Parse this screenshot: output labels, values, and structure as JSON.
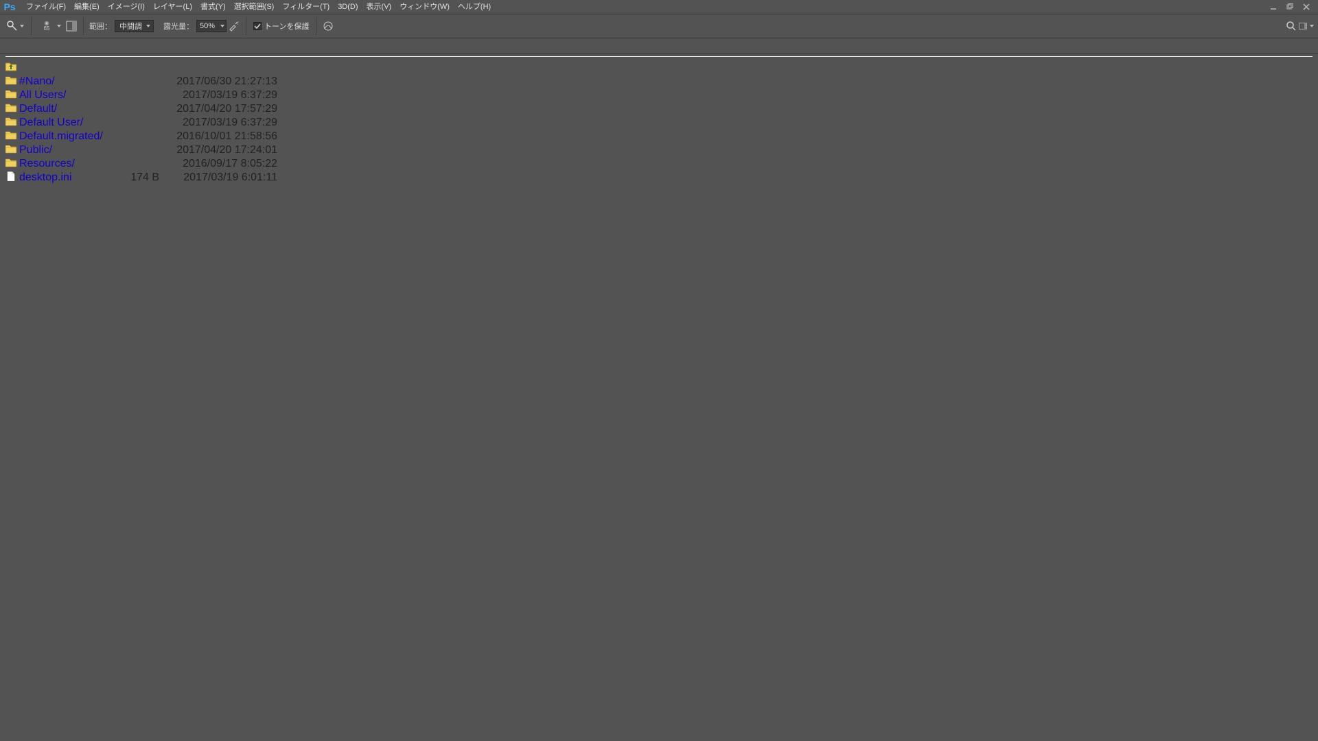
{
  "menubar": {
    "items": [
      "ファイル(F)",
      "編集(E)",
      "イメージ(I)",
      "レイヤー(L)",
      "書式(Y)",
      "選択範囲(S)",
      "フィルター(T)",
      "3D(D)",
      "表示(V)",
      "ウィンドウ(W)",
      "ヘルプ(H)"
    ]
  },
  "options": {
    "brush_size": "65",
    "range_label": "範囲：",
    "range_value": "中間調",
    "exposure_label": "露光量：",
    "exposure_value": "50%",
    "protect_tones": "トーンを保護"
  },
  "filelist": {
    "rows": [
      {
        "type": "up",
        "name": "",
        "size": "",
        "date": ""
      },
      {
        "type": "folder",
        "name": "#Nano/",
        "size": "",
        "date": "2017/06/30 21:27:13"
      },
      {
        "type": "folder",
        "name": "All Users/",
        "size": "",
        "date": "2017/03/19 6:37:29"
      },
      {
        "type": "folder",
        "name": "Default/",
        "size": "",
        "date": "2017/04/20 17:57:29"
      },
      {
        "type": "folder",
        "name": "Default User/",
        "size": "",
        "date": "2017/03/19 6:37:29"
      },
      {
        "type": "folder",
        "name": "Default.migrated/",
        "size": "",
        "date": "2016/10/01 21:58:56"
      },
      {
        "type": "folder",
        "name": "Public/",
        "size": "",
        "date": "2017/04/20 17:24:01"
      },
      {
        "type": "folder",
        "name": "Resources/",
        "size": "",
        "date": "2016/09/17 8:05:22"
      },
      {
        "type": "file",
        "name": "desktop.ini",
        "size": "174 B",
        "date": "2017/03/19 6:01:11"
      }
    ]
  }
}
